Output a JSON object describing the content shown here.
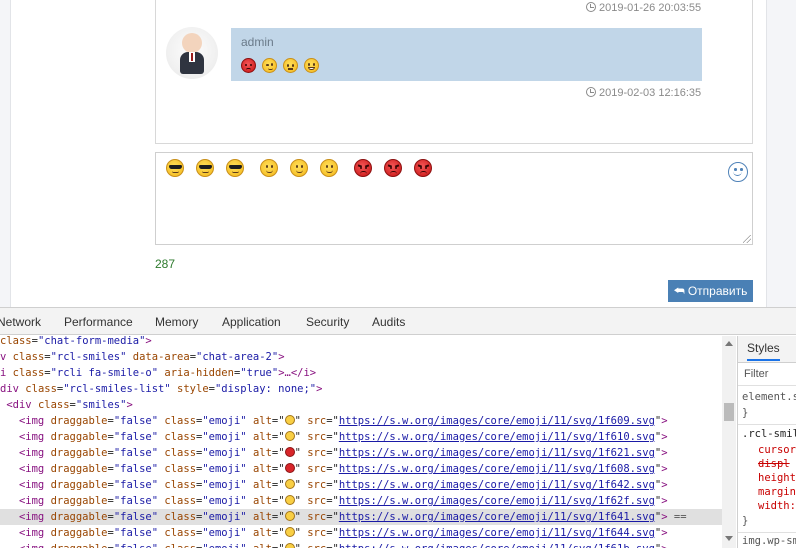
{
  "chat": {
    "messages": [
      {
        "time": "2019-01-26 20:03:55"
      },
      {
        "author": "admin",
        "emojis": [
          "angry",
          "smirk",
          "neutral",
          "grin"
        ],
        "time": "2019-02-03 12:16:35"
      }
    ]
  },
  "composer": {
    "emojis": [
      "sunglasses",
      "sunglasses",
      "sunglasses",
      "slight-smile",
      "slight-smile",
      "slight-smile",
      "angry",
      "angry",
      "angry"
    ],
    "counter": "287",
    "send_label": "Отправить",
    "send_icon": "reply-icon",
    "smiles_icon": "smile-o-icon"
  },
  "devtools": {
    "tabs": [
      "Network",
      "Performance",
      "Memory",
      "Application",
      "Security",
      "Audits"
    ],
    "styles_tab": "Styles",
    "styles_filter": "Filter",
    "styles_rules": [
      "element.s",
      "}",
      ".rcl-smil",
      "cursor",
      "displ",
      "height",
      "margin",
      "width:",
      "}",
      "img.wp-sm"
    ],
    "dom_lines": [
      {
        "parts": [
          [
            "attr",
            "class"
          ],
          [
            "txt",
            "="
          ],
          [
            "val",
            "\"chat-form-media\""
          ],
          [
            "tag",
            ">"
          ]
        ]
      },
      {
        "parts": [
          [
            "tag",
            "v "
          ],
          [
            "attr",
            "class"
          ],
          [
            "txt",
            "="
          ],
          [
            "val",
            "\"rcl-smiles\""
          ],
          [
            "txt",
            " "
          ],
          [
            "attr",
            "data-area"
          ],
          [
            "txt",
            "="
          ],
          [
            "val",
            "\"chat-area-2\""
          ],
          [
            "tag",
            ">"
          ]
        ]
      },
      {
        "parts": [
          [
            "tag",
            "i "
          ],
          [
            "attr",
            "class"
          ],
          [
            "txt",
            "="
          ],
          [
            "val",
            "\"rcli fa-smile-o\""
          ],
          [
            "txt",
            " "
          ],
          [
            "attr",
            "aria-hidden"
          ],
          [
            "txt",
            "="
          ],
          [
            "val",
            "\"true\""
          ],
          [
            "tag",
            ">…</i>"
          ]
        ]
      },
      {
        "parts": [
          [
            "tag",
            "div "
          ],
          [
            "attr",
            "class"
          ],
          [
            "txt",
            "="
          ],
          [
            "val",
            "\"rcl-smiles-list\""
          ],
          [
            "txt",
            " "
          ],
          [
            "attr",
            "style"
          ],
          [
            "txt",
            "="
          ],
          [
            "val",
            "\"display: none;\""
          ],
          [
            "tag",
            ">"
          ]
        ]
      },
      {
        "parts": [
          [
            "tag",
            " <div "
          ],
          [
            "attr",
            "class"
          ],
          [
            "txt",
            "="
          ],
          [
            "val",
            "\"smiles\""
          ],
          [
            "tag",
            ">"
          ]
        ]
      },
      {
        "img": true,
        "glyph": "y",
        "src": "https://s.w.org/images/core/emoji/11/svg/1f609.svg"
      },
      {
        "img": true,
        "glyph": "y",
        "src": "https://s.w.org/images/core/emoji/11/svg/1f610.svg"
      },
      {
        "img": true,
        "glyph": "r",
        "src": "https://s.w.org/images/core/emoji/11/svg/1f621.svg"
      },
      {
        "img": true,
        "glyph": "r",
        "src": "https://s.w.org/images/core/emoji/11/svg/1f608.svg"
      },
      {
        "img": true,
        "glyph": "y",
        "src": "https://s.w.org/images/core/emoji/11/svg/1f642.svg"
      },
      {
        "img": true,
        "glyph": "y",
        "src": "https://s.w.org/images/core/emoji/11/svg/1f62f.svg"
      },
      {
        "img": true,
        "glyph": "y",
        "src": "https://s.w.org/images/core/emoji/11/svg/1f641.svg",
        "selected": true,
        "suffix": " =="
      },
      {
        "img": true,
        "glyph": "y",
        "src": "https://s.w.org/images/core/emoji/11/svg/1f644.svg"
      },
      {
        "img": true,
        "glyph": "y",
        "src": "https://s.w.org/images/core/emoji/11/svg/1f61b.svg"
      }
    ],
    "img_parts": {
      "open": "<img ",
      "draggable": "draggable",
      "false": "\"false\"",
      "class": "class",
      "emoji": "\"emoji\"",
      "alt": "alt",
      "src": "src"
    }
  },
  "colors": {
    "bubble": "#c1d6e8",
    "button": "#4a80b5",
    "counter": "#2d7a2d",
    "accent": "#4f82b8"
  }
}
